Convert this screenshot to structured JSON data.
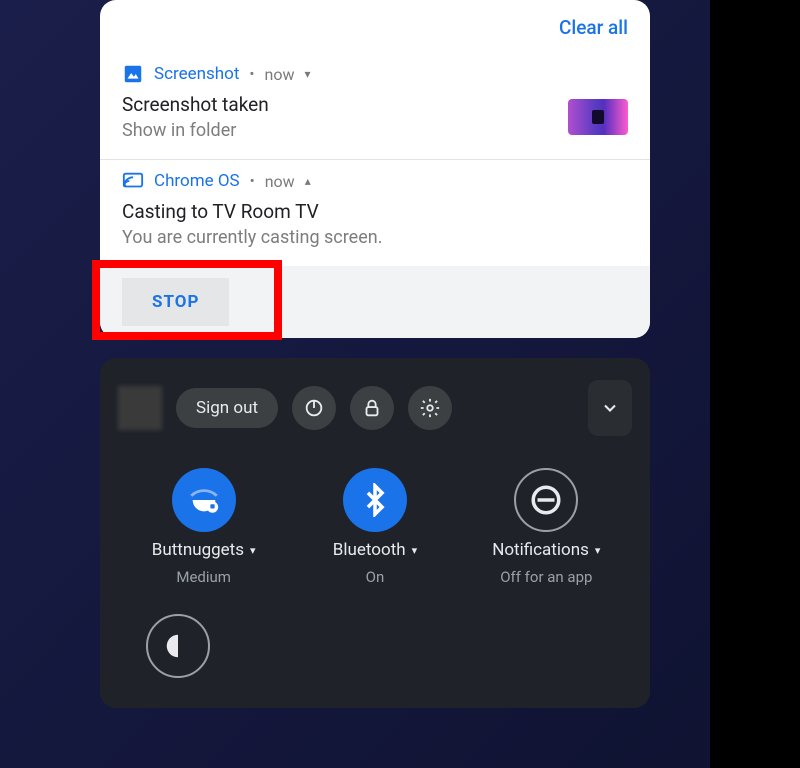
{
  "header": {
    "clear_all": "Clear all"
  },
  "notifications": [
    {
      "app": "Screenshot",
      "time": "now",
      "expanded": false,
      "title": "Screenshot taken",
      "subtitle": "Show in folder",
      "has_thumb": true
    },
    {
      "app": "Chrome OS",
      "time": "now",
      "expanded": true,
      "title": "Casting to TV Room TV",
      "subtitle": "You are currently casting screen.",
      "action": "STOP"
    }
  ],
  "tray": {
    "sign_out": "Sign out",
    "quick_settings": [
      {
        "id": "wifi",
        "label": "Buttnuggets",
        "sub": "Medium",
        "state": "on"
      },
      {
        "id": "bluetooth",
        "label": "Bluetooth",
        "sub": "On",
        "state": "on"
      },
      {
        "id": "notifications",
        "label": "Notifications",
        "sub": "Off for an app",
        "state": "off"
      }
    ]
  },
  "colors": {
    "accent": "#1a73e8",
    "highlight": "#ff0000"
  }
}
